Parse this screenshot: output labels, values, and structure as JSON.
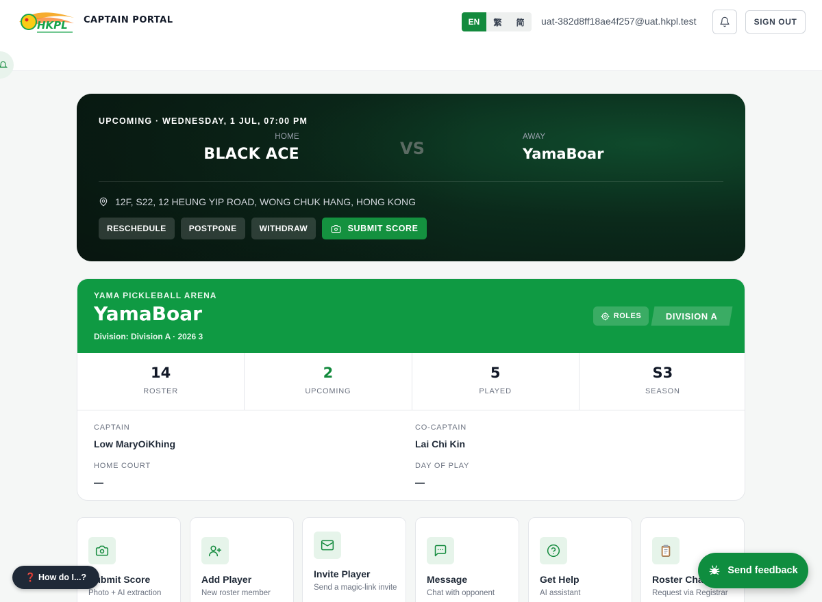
{
  "header": {
    "logo_text": "HKPL",
    "brand": "CAPTAIN PORTAL",
    "languages": [
      "EN",
      "繁",
      "简"
    ],
    "active_language": "EN",
    "user_email": "uat-382d8ff18ae4f257@uat.hkpl.test",
    "bell_icon": "bell-icon",
    "sign_out": "SIGN OUT"
  },
  "match": {
    "status": "UPCOMING · WEDNESDAY, 1 JUL, 07:00 PM",
    "home_label": "HOME",
    "home_team": "BLACK ACE",
    "vs": "VS",
    "away_label": "AWAY",
    "away_team": "YamaBoar",
    "venue": "12F, S22, 12 HEUNG YIP ROAD, WONG CHUK HANG, HONG KONG",
    "actions": {
      "reschedule": "RESCHEDULE",
      "postpone": "POSTPONE",
      "withdraw": "WITHDRAW",
      "submit_score": "SUBMIT SCORE"
    }
  },
  "team": {
    "arena": "YAMA PICKLEBALL ARENA",
    "name": "YamaBoar",
    "division_line": "Division: Division A · 2026 3",
    "roles": "ROLES",
    "division_badge": "DIVISION A",
    "stats": [
      {
        "value": "14",
        "label": "ROSTER"
      },
      {
        "value": "2",
        "label": "UPCOMING"
      },
      {
        "value": "5",
        "label": "PLAYED"
      },
      {
        "value": "S3",
        "label": "SEASON"
      }
    ],
    "captain_label": "CAPTAIN",
    "captain": "Low MaryOiKhing",
    "co_captain_label": "CO-CAPTAIN",
    "co_captain": "Lai Chi Kin",
    "home_court_label": "HOME COURT",
    "home_court": "—",
    "day_of_play_label": "DAY OF PLAY",
    "day_of_play": "—"
  },
  "quick_actions": [
    {
      "title": "Submit Score",
      "subtitle": "Photo + AI extraction",
      "icon": "camera-icon"
    },
    {
      "title": "Add Player",
      "subtitle": "New roster member",
      "icon": "user-plus-icon"
    },
    {
      "title": "Invite Player",
      "subtitle": "Send a magic-link invite",
      "icon": "mail-icon"
    },
    {
      "title": "Message",
      "subtitle": "Chat with opponent",
      "icon": "chat-icon"
    },
    {
      "title": "Get Help",
      "subtitle": "AI assistant",
      "icon": "help-circle-icon"
    },
    {
      "title": "Roster Changes",
      "subtitle": "Request via Registrar",
      "icon": "clipboard-icon"
    }
  ],
  "floating": {
    "help": "❓ How do I...?",
    "feedback": "Send feedback"
  },
  "colors": {
    "accent": "#138a3d",
    "team_banner": "#0f9a43",
    "match_card": "#0b2a1b"
  }
}
